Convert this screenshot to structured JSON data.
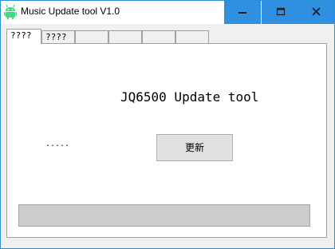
{
  "window": {
    "title": "Music Update tool V1.0"
  },
  "tabs": [
    {
      "label": "????",
      "active": true
    },
    {
      "label": "????",
      "active": false
    },
    {
      "label": "",
      "active": false
    },
    {
      "label": "",
      "active": false
    },
    {
      "label": "",
      "active": false
    },
    {
      "label": "",
      "active": false
    }
  ],
  "main": {
    "heading": "JQ6500 Update tool",
    "status_text": ".....",
    "update_button_label": "更新",
    "progress_percent": 0
  },
  "colors": {
    "titlebar_button": "#2f8fe0",
    "window_border": "#2b8fd6",
    "progress_track": "#cdcdcd"
  },
  "icons": {
    "app": "android-robot-icon",
    "minimize": "minimize-icon",
    "maximize": "maximize-icon",
    "close": "close-icon"
  }
}
